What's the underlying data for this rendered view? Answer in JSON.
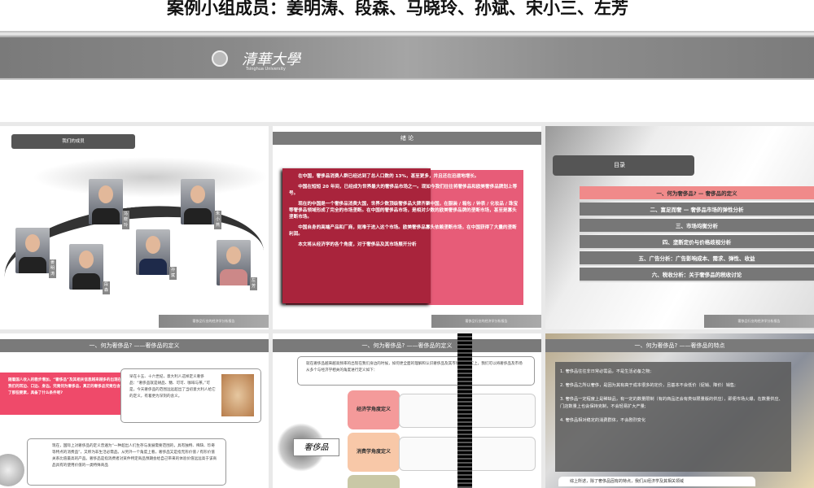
{
  "header": {
    "title": "案例小组成员：姜明涛、段森、马晓玲、孙斌、宋小三、左芳",
    "logo": "清華大學",
    "logo_sub": "Tsinghua University"
  },
  "footer_text": "奢侈品行业的经济学分析报告",
  "slides": [
    {
      "heading": "我们的成员",
      "members": [
        "姜明涛",
        "段森",
        "马晓玲",
        "孙斌",
        "朱小燕",
        "左芳"
      ]
    },
    {
      "heading": "绪 论",
      "paragraphs": [
        "在中国，奢侈品消费人群已经达到了总人口数的 13%，甚至更多，并且还在迅速地增长。",
        "中国在短短 20 年间，已经成为世界最大的奢侈品市场之一。现如今我们往往将奢侈品和欧美奢侈品牌划上等号。",
        "现在的中国是一个奢侈品消费大国，世界少数顶级奢侈品大牌齐聚中国，在服装 / 箱包 / 钟表 / 化妆品 / 珠宝等奢侈品领域形成了完全的市场垄断。在中国的奢侈品市场，是相对少数的欧美奢侈品牌的垄断市场，甚至是寡头垄断市场。",
        "中国自身的高端产品和厂商，则难于进入这个市场。欧美奢侈品寡头依赖垄断市场，在中国获得了大量的垄断利润。",
        "本文将从经济学的各个角度，对于奢侈品及其市场展开分析"
      ]
    },
    {
      "heading": "目录",
      "items": [
        "一、何为奢侈品? — 奢侈品的定义",
        "二、富足而奢 — 奢侈品市场的弹性分析",
        "三、市场均衡分析",
        "四、垄断定价与价格歧视分析",
        "五、广告分析：广告影响成本、需求、弹性、收益",
        "六、税收分析：关于奢侈品的税收讨论"
      ]
    },
    {
      "heading": "一、何为奢侈品? ——奢侈品的定义",
      "band": "随着国人收入的稳步增加，“奢侈品”及其相关信息越来越多的出现在我们的耳边、口边、身边。究竟何为奢侈品，真正的奢侈品究竟包含了那些要素，具备了什么条件呢?",
      "quote": "早在十五、十六世纪，意大利人这样定义奢侈品：“奢侈品就是胡品、糖、可可、咖啡与茶。”可是，今天奢侈品的范围远远超出了当初意大利人给它的定义，有着更为深刻的含义。",
      "def": "现在，国际上对奢侈品的定义普遍为“一种超出人们生存与发展需要范围的，具有独特、稀缺、珍奇等特点的消费品”，又称为非生活必需品。从另外一个角度上看，奢侈品又是指无形价值 / 有形价值关系比值最高的产品。奢侈品是指消费者对某件特定商品预期会给自己带来的体验价值远远高于该商品具有的使用价值的一类特殊商品"
    },
    {
      "heading": "一、何为奢侈品? ——奢侈品的定义",
      "intro": "就在奢侈品越来越高频率的出现在我们身边的时候，如何更全面的理解和认识奢侈品及其市场呢? 事实上，我们可以将奢侈品及市场从多个与经济学相关的角度进行定义如下：",
      "center": "奢侈品",
      "concepts": [
        "经济学角度定义",
        "消费学角度定义"
      ]
    },
    {
      "heading": "一、何为奢侈品? ——奢侈品的特点",
      "points": [
        "1. 奢侈品往往非日常必需品，不是生活必备之物;",
        "2. 奢侈品之所以奢侈，是因为其有高于成本很多的定价，且基本不会低价（促销、降价）销售;",
        "3. 奢侈品一定程度上是稀缺品，有一定的数量限制（有的商品还会有类似限量版的供应），即便市场火爆，在数量供应、门店数量上也会保持克制，不会轻易扩大产量;",
        "4. 奢侈品相对稳定的消费群体，不会剧烈变化"
      ],
      "summary": "综上所述，除了奢侈品固有的特点，我们从经济学及其相关领域"
    }
  ],
  "colors": {
    "accent": "#e75c78",
    "header": "#7a7a7a"
  }
}
